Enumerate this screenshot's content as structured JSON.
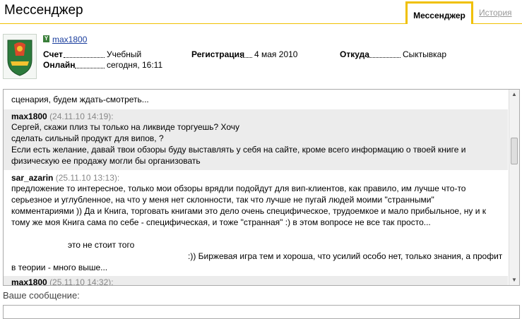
{
  "header": {
    "title": "Мессенджер",
    "tab_messenger": "Мессенджер",
    "tab_history": "История"
  },
  "profile": {
    "username": "max1800",
    "account_label": "Счет",
    "account_value": "Учебный",
    "online_label": "Онлайн",
    "online_value": "сегодня, 16:11",
    "reg_label": "Регистрация",
    "reg_value": "4 мая 2010",
    "from_label": "Откуда",
    "from_value": "Сыктывкар"
  },
  "messages": [
    {
      "author": "",
      "time": "",
      "lines": [
        "сценария, будем ждать-смотреть..."
      ]
    },
    {
      "author": "max1800",
      "time": "(24.11.10 14:19):",
      "lines": [
        "Сергей, скажи плиз ты только на ликвиде торгуешь? Хочу",
        "сделать сильный продукт для випов, ?",
        "Если есть желание, давай твои обзоры буду выставлять у себя на сайте, кроме всего информацию о твоей книге и",
        "физическую ее продажу могли бы организовать"
      ]
    },
    {
      "author": "sar_azarin",
      "time": "(25.11.10 13:13):",
      "lines": [
        "предложение то интересное, только мои обзоры врядли подойдут для вип-клиентов, как правило, им лучше что-то",
        "серьезное и углубленное, на что у меня нет склонности, так что лучше не пугай людей моими \"странными\"",
        "комментариями )) Да и Книга, торговать книгами это дело очень специфическое, трудоемкое и мало прибыльное, ну и к",
        "тому же моя Книга сама по себе - специфическая, и тоже \"странная\" :) в этом вопросе не все так просто...",
        "",
        "это не стоит того",
        ":)) Биржевая игра тем и хороша, что усилий особо нет, только знания, а профит",
        "в теории - много выше..."
      ]
    },
    {
      "author": "max1800",
      "time": "(25.11.10 14:32):",
      "lines": []
    }
  ],
  "composer": {
    "label": "Ваше сообщение:",
    "placeholder": ""
  }
}
